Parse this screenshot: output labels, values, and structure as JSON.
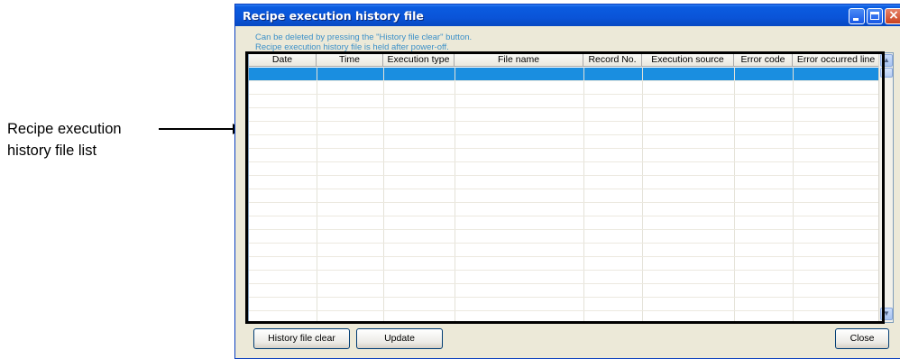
{
  "annotation": {
    "line1": "Recipe execution",
    "line2": "history file list"
  },
  "window": {
    "title": "Recipe execution history file",
    "info_line1": "Can be deleted by pressing the \"History file clear\" button.",
    "info_line2": "Recipe execution history file is held after power-off.",
    "controls": {
      "close_glyph": "×"
    }
  },
  "table": {
    "columns": [
      "Date",
      "Time",
      "Execution type",
      "File name",
      "Record No.",
      "Execution source",
      "Error code",
      "Error occurred line"
    ],
    "rows": [],
    "selected_row_index": 0
  },
  "buttons": {
    "history_clear": "History file clear",
    "update": "Update",
    "close": "Close"
  },
  "icons": {
    "scroll_up": "▲",
    "scroll_down": "▼"
  },
  "colors": {
    "titlebar": "#0a54d8",
    "selection": "#1a8ee0",
    "info_text": "#3c90c8"
  }
}
